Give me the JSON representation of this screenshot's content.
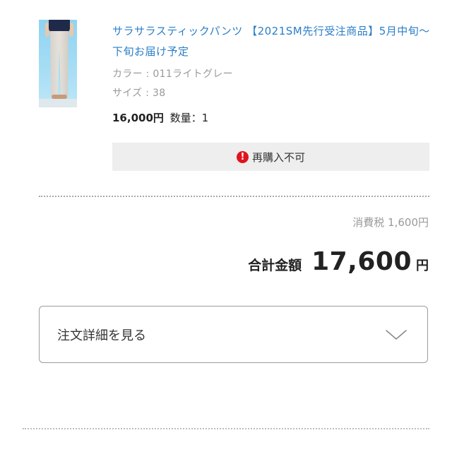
{
  "product": {
    "title": "サラサラスティックパンツ 【2021SM先行受注商品】5月中旬〜下旬お届け予定",
    "color": "カラー : 011ライトグレー",
    "size": "サイズ : 38",
    "price": "16,000円",
    "quantity": "数量：1",
    "rebuy_status": "再購入不可",
    "rebuy_icon": "!"
  },
  "summary": {
    "tax": "消費税 1,600円",
    "total_label": "合計金額",
    "total_amount": "17,600",
    "total_currency": "円"
  },
  "details_toggle": {
    "label": "注文詳細を見る"
  },
  "colors": {
    "link_blue": "#2a7ec8",
    "warning_red": "#e0141e",
    "muted_gray": "#9a9a9a"
  },
  "icons": {
    "warning": "exclamation-circle-icon",
    "expand": "chevron-down-icon"
  }
}
